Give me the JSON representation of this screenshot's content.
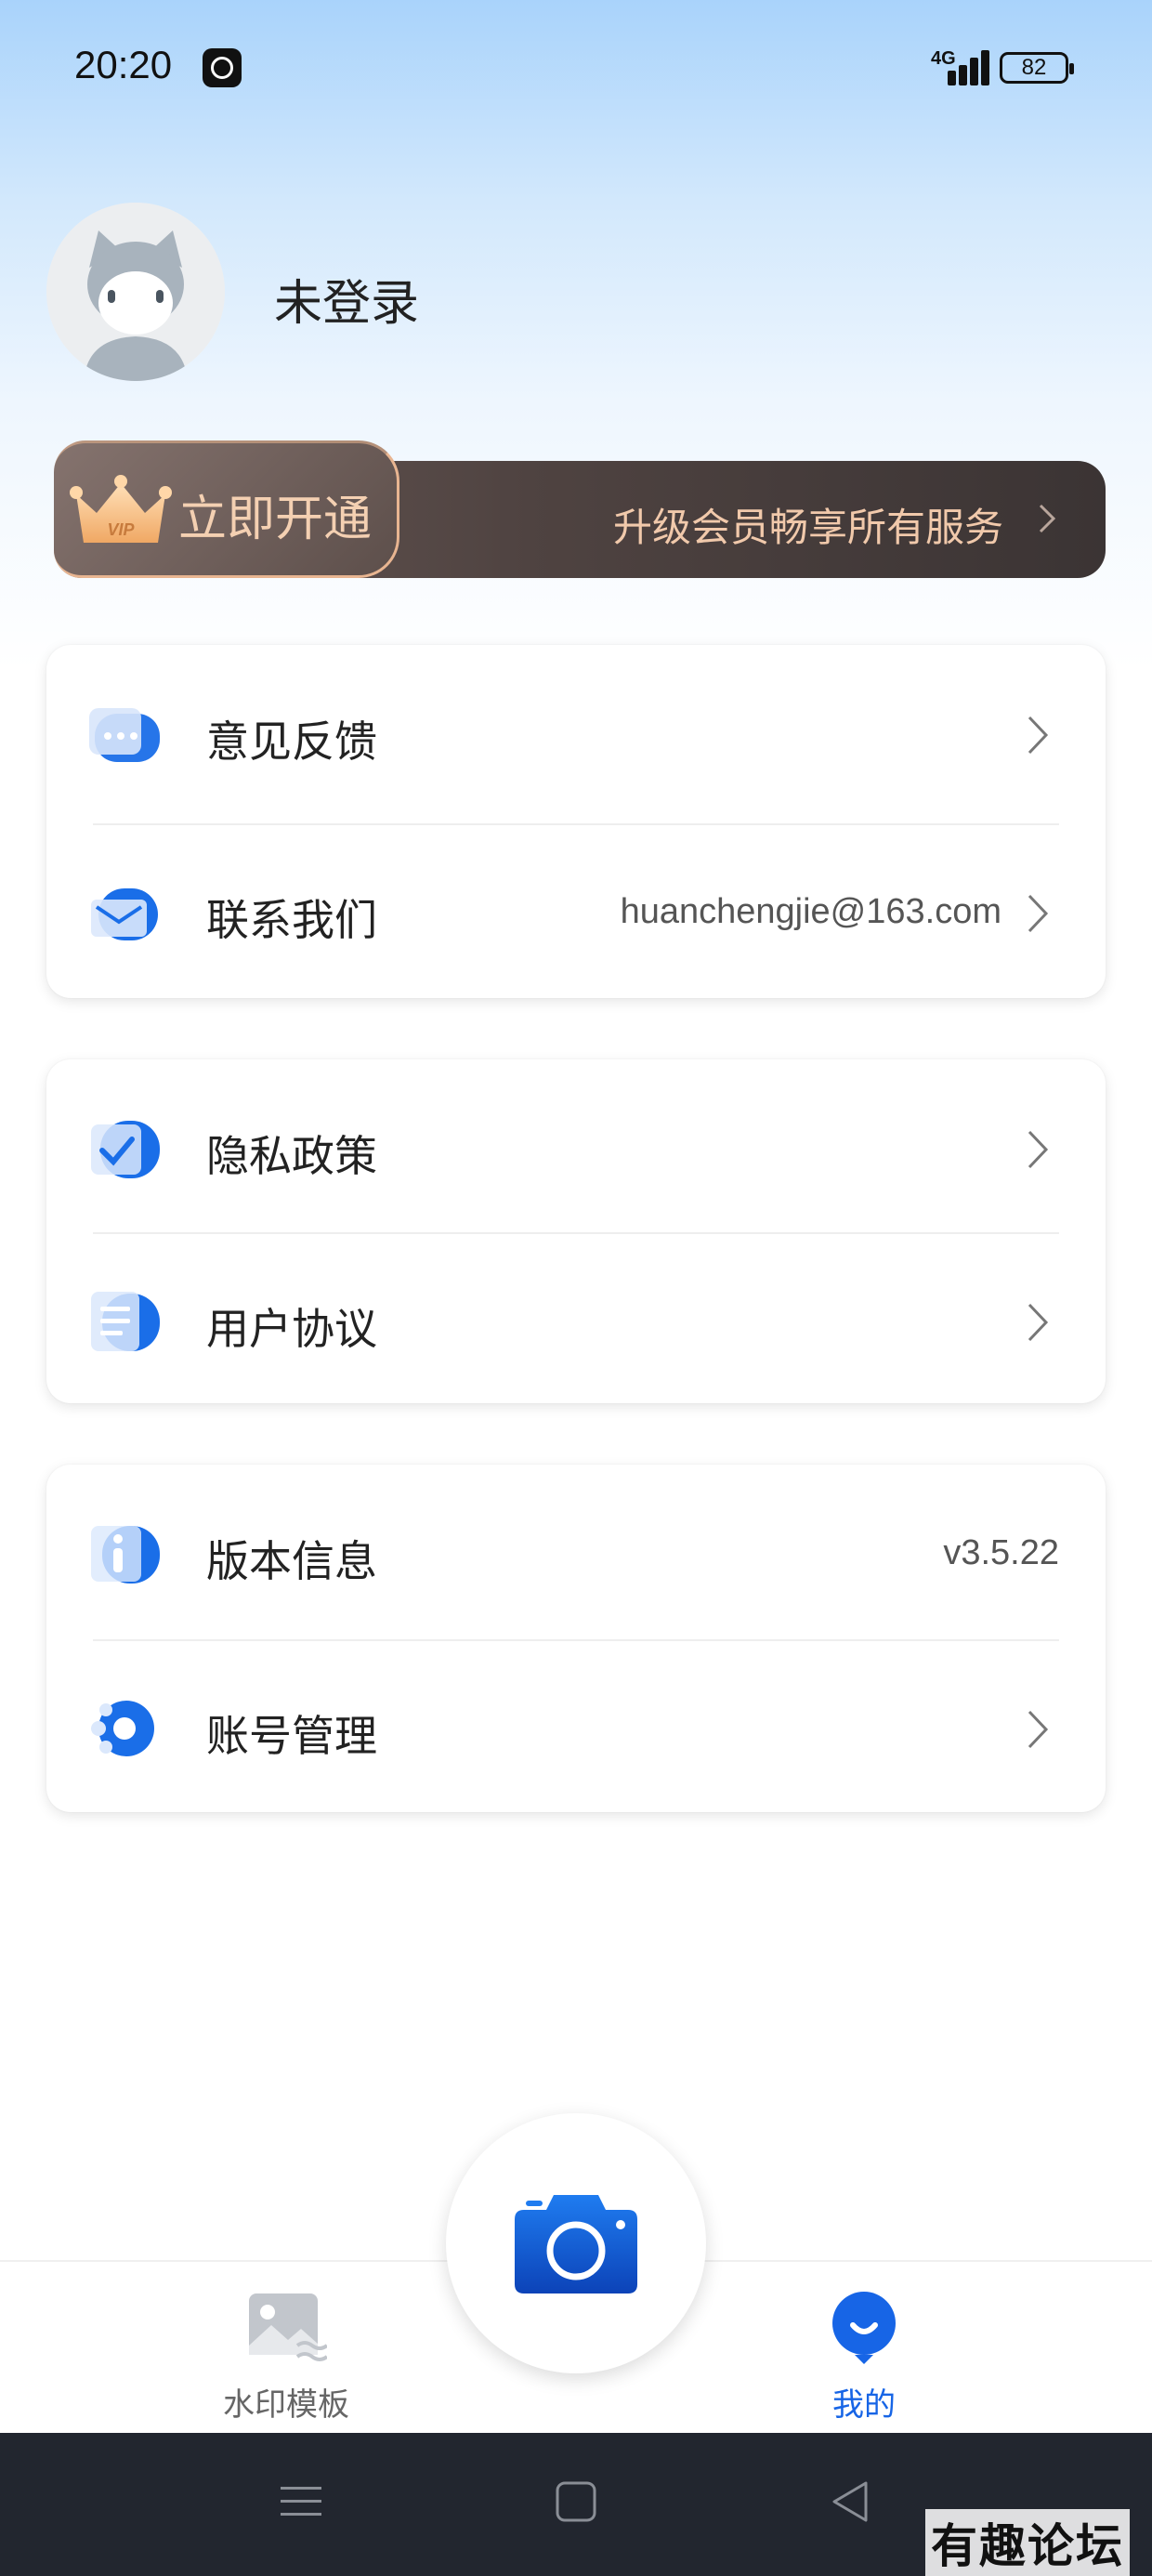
{
  "status_bar": {
    "time": "20:20",
    "network": "4G",
    "battery": "82"
  },
  "profile": {
    "login_status": "未登录"
  },
  "vip": {
    "badge_text": "VIP",
    "open_label": "立即开通",
    "description": "升级会员畅享所有服务"
  },
  "menu": {
    "feedback": {
      "label": "意见反馈"
    },
    "contact": {
      "label": "联系我们",
      "value": "huanchengjie@163.com"
    },
    "privacy": {
      "label": "隐私政策"
    },
    "agreement": {
      "label": "用户协议"
    },
    "version": {
      "label": "版本信息",
      "value": "v3.5.22"
    },
    "account": {
      "label": "账号管理"
    }
  },
  "tabbar": {
    "templates": {
      "label": "水印模板"
    },
    "mine": {
      "label": "我的"
    }
  },
  "watermark_text": "有趣论坛",
  "colors": {
    "accent": "#1765e6",
    "tab_inactive": "#666666",
    "vip_gold": "#f1c9ab"
  }
}
